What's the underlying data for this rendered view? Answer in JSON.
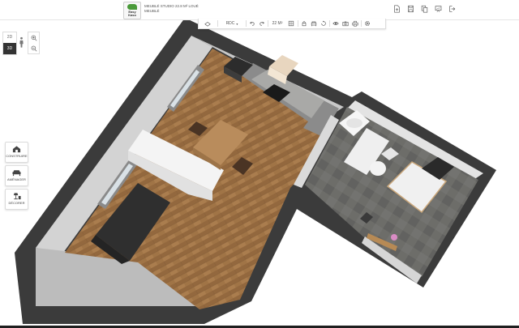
{
  "header": {
    "logo_text": "Easy Kaso",
    "project_title": "MEUBLÉ STUDIO 22.8 M² LOUÉ",
    "project_subtitle": "MEUBLÉ"
  },
  "toolbar": {
    "level_label": "RDC",
    "surface_label": "22 M²",
    "icons": [
      "floor-plan-icon",
      "undo-icon",
      "redo-icon",
      "measure-icon",
      "lock-icon",
      "furniture-icon",
      "rotate-icon",
      "eye-icon",
      "camera-icon",
      "print-icon",
      "settings-icon"
    ]
  },
  "top_icons": [
    "new-file-icon",
    "save-icon",
    "copy-icon",
    "presentation-icon",
    "exit-icon"
  ],
  "view_controls": {
    "mode_2d": "2D",
    "mode_3d": "3D"
  },
  "side_menu": {
    "items": [
      {
        "label": "CONSTRUIRE",
        "icon": "house-icon"
      },
      {
        "label": "AMÉNAGER",
        "icon": "sofa-icon"
      },
      {
        "label": "DÉCORER",
        "icon": "lamp-icon"
      }
    ]
  },
  "colors": {
    "wall_top": "#3a3a3a",
    "wood_floor": "#9c7045",
    "bath_floor": "#6a6a66",
    "accent_green": "#4a9a3a"
  }
}
